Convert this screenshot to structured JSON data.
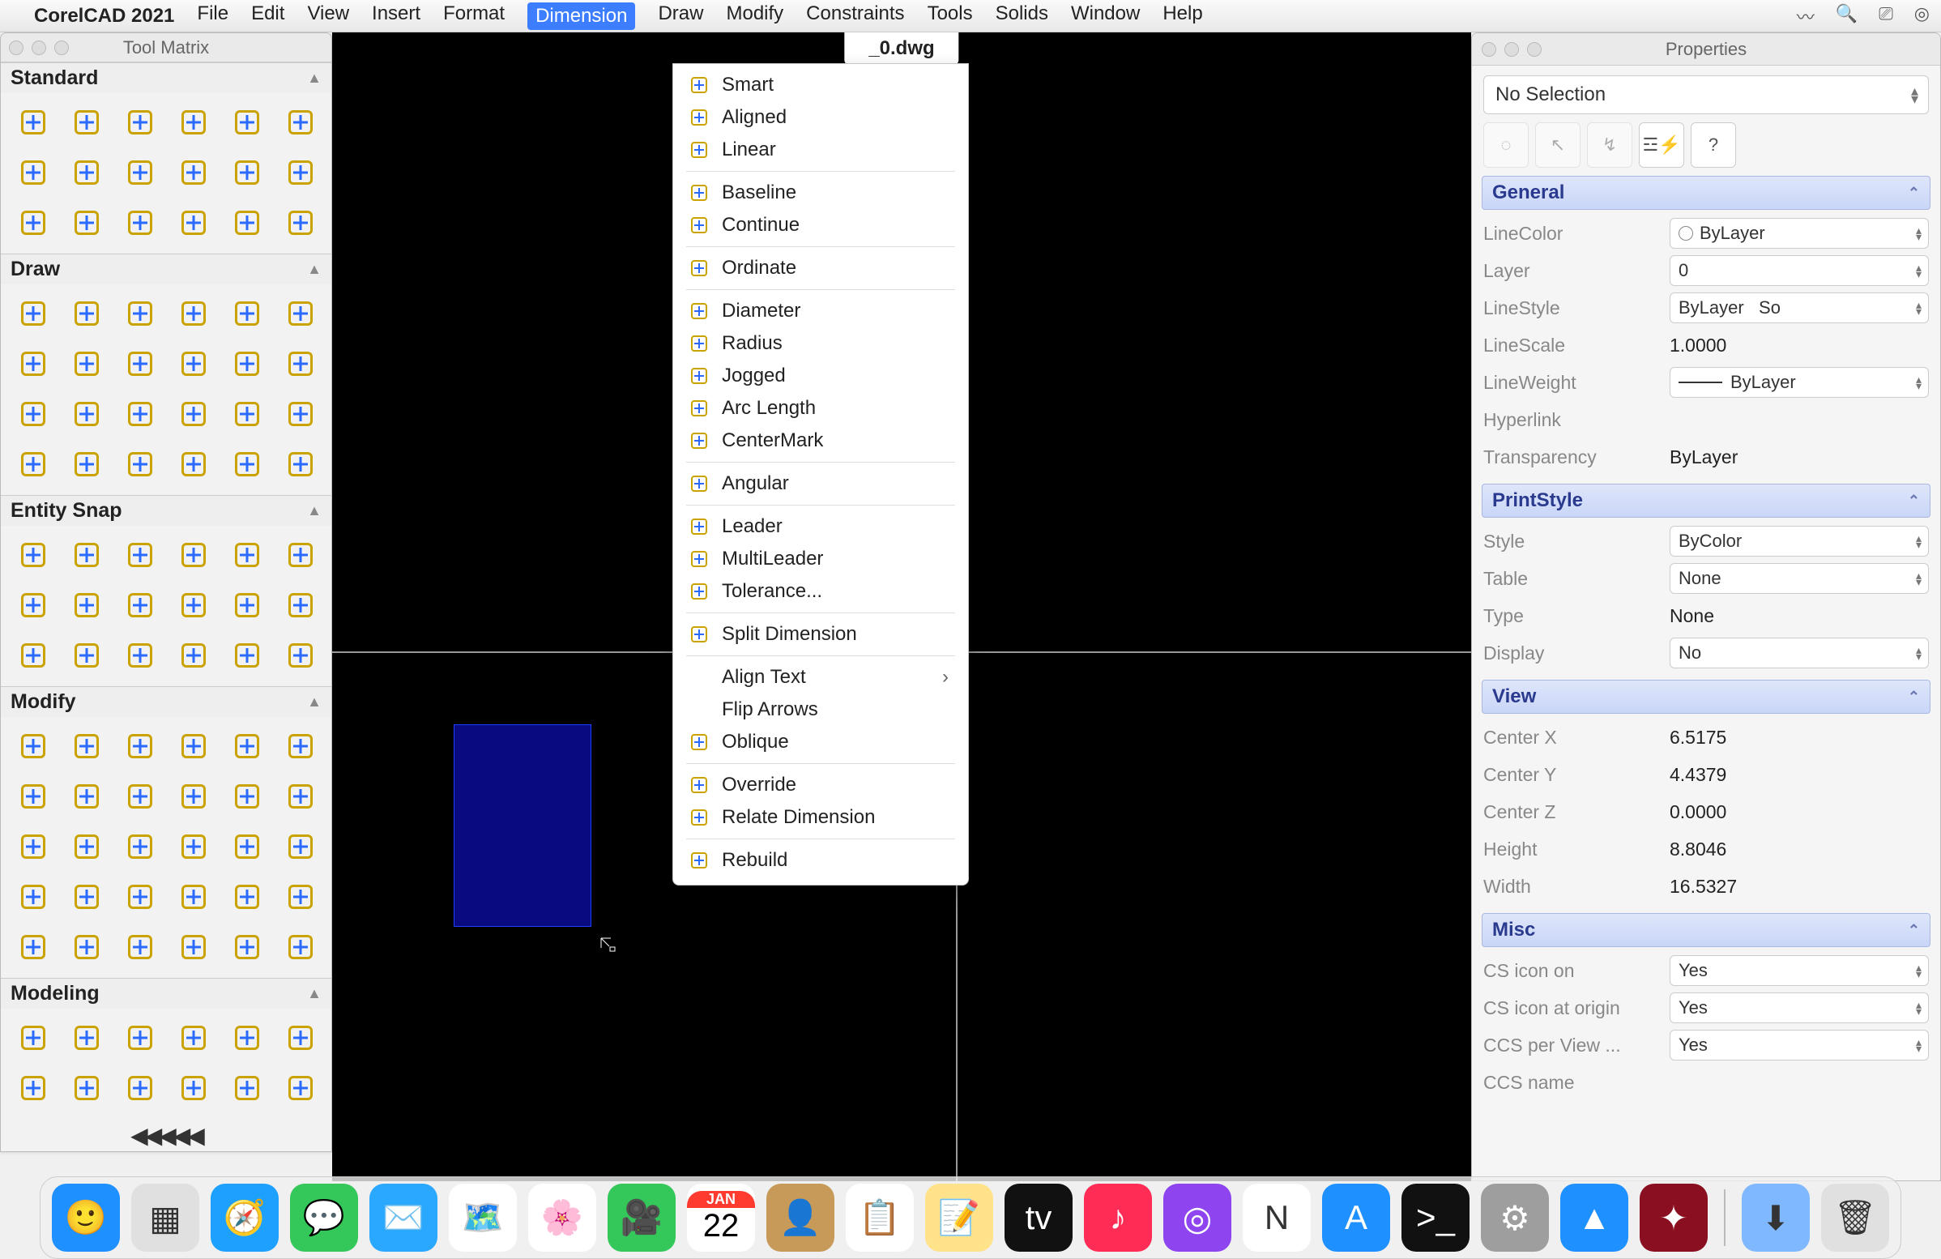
{
  "menubar": {
    "app_name": "CorelCAD 2021",
    "items": [
      "File",
      "Edit",
      "View",
      "Insert",
      "Format",
      "Dimension",
      "Draw",
      "Modify",
      "Constraints",
      "Tools",
      "Solids",
      "Window",
      "Help"
    ],
    "open_index": 5
  },
  "system_status": {
    "date_badge": {
      "month": "JAN",
      "day": "22"
    }
  },
  "toolmatrix": {
    "title": "Tool Matrix",
    "sections": [
      {
        "name": "Standard",
        "rows": 3,
        "cols": 6
      },
      {
        "name": "Draw",
        "rows": 4,
        "cols": 6
      },
      {
        "name": "Entity Snap",
        "rows": 3,
        "cols": 6
      },
      {
        "name": "Modify",
        "rows": 5,
        "cols": 6
      },
      {
        "name": "Modeling",
        "rows": 2,
        "cols": 6
      }
    ]
  },
  "document": {
    "tab_label": "_0.dwg"
  },
  "dimension_menu": {
    "groups": [
      [
        {
          "label": "Smart",
          "icon": "smart-dim"
        },
        {
          "label": "Aligned",
          "icon": "aligned-dim"
        },
        {
          "label": "Linear",
          "icon": "linear-dim"
        }
      ],
      [
        {
          "label": "Baseline",
          "icon": "baseline-dim"
        },
        {
          "label": "Continue",
          "icon": "continue-dim"
        }
      ],
      [
        {
          "label": "Ordinate",
          "icon": "ordinate-dim"
        }
      ],
      [
        {
          "label": "Diameter",
          "icon": "diameter-dim"
        },
        {
          "label": "Radius",
          "icon": "radius-dim"
        },
        {
          "label": "Jogged",
          "icon": "jogged-dim"
        },
        {
          "label": "Arc Length",
          "icon": "arclen-dim"
        },
        {
          "label": "CenterMark",
          "icon": "centermark-dim"
        }
      ],
      [
        {
          "label": "Angular",
          "icon": "angular-dim"
        }
      ],
      [
        {
          "label": "Leader",
          "icon": "leader-dim"
        },
        {
          "label": "MultiLeader",
          "icon": "multileader-dim"
        },
        {
          "label": "Tolerance...",
          "icon": "tolerance-dim"
        }
      ],
      [
        {
          "label": "Split Dimension",
          "icon": "split-dim"
        }
      ],
      [
        {
          "label": "Align Text",
          "icon": "",
          "submenu": true
        },
        {
          "label": "Flip Arrows",
          "icon": ""
        },
        {
          "label": "Oblique",
          "icon": "oblique-dim"
        }
      ],
      [
        {
          "label": "Override",
          "icon": "override-dim"
        },
        {
          "label": "Relate Dimension",
          "icon": "relate-dim"
        }
      ],
      [
        {
          "label": "Rebuild",
          "icon": "rebuild-dim"
        }
      ]
    ]
  },
  "properties": {
    "title": "Properties",
    "selection": "No Selection",
    "toolbar_help": "?",
    "groups": [
      {
        "name": "General",
        "rows": [
          {
            "label": "LineColor",
            "type": "select",
            "value": "ByLayer",
            "swatch": true
          },
          {
            "label": "Layer",
            "type": "select",
            "value": "0"
          },
          {
            "label": "LineStyle",
            "type": "select",
            "value": "ByLayer",
            "extra": "So"
          },
          {
            "label": "LineScale",
            "type": "value",
            "value": "1.0000"
          },
          {
            "label": "LineWeight",
            "type": "select",
            "value": "ByLayer",
            "line": true
          },
          {
            "label": "Hyperlink",
            "type": "value",
            "value": ""
          },
          {
            "label": "Transparency",
            "type": "value",
            "value": "ByLayer"
          }
        ]
      },
      {
        "name": "PrintStyle",
        "rows": [
          {
            "label": "Style",
            "type": "select",
            "value": "ByColor"
          },
          {
            "label": "Table",
            "type": "select",
            "value": "None"
          },
          {
            "label": "Type",
            "type": "value",
            "value": "None"
          },
          {
            "label": "Display",
            "type": "select",
            "value": "No"
          }
        ]
      },
      {
        "name": "View",
        "rows": [
          {
            "label": "Center X",
            "type": "value",
            "value": "6.5175"
          },
          {
            "label": "Center Y",
            "type": "value",
            "value": "4.4379"
          },
          {
            "label": "Center Z",
            "type": "value",
            "value": "0.0000"
          },
          {
            "label": "Height",
            "type": "value",
            "value": "8.8046"
          },
          {
            "label": "Width",
            "type": "value",
            "value": "16.5327"
          }
        ]
      },
      {
        "name": "Misc",
        "rows": [
          {
            "label": "CS icon on",
            "type": "select",
            "value": "Yes"
          },
          {
            "label": "CS icon at origin",
            "type": "select",
            "value": "Yes"
          },
          {
            "label": "CCS per View ...",
            "type": "select",
            "value": "Yes"
          },
          {
            "label": "CCS name",
            "type": "value",
            "value": ""
          }
        ]
      }
    ]
  },
  "dock": {
    "apps": [
      {
        "name": "finder",
        "bg": "#1e90ff",
        "glyph": "🙂"
      },
      {
        "name": "launchpad",
        "bg": "#e0e0e0",
        "glyph": "▦"
      },
      {
        "name": "safari",
        "bg": "#1ea0ff",
        "glyph": "🧭"
      },
      {
        "name": "messages",
        "bg": "#34c759",
        "glyph": "💬"
      },
      {
        "name": "mail",
        "bg": "#2aa7ff",
        "glyph": "✉️"
      },
      {
        "name": "maps",
        "bg": "#fff",
        "glyph": "🗺️"
      },
      {
        "name": "photos",
        "bg": "#fff",
        "glyph": "🌸"
      },
      {
        "name": "facetime",
        "bg": "#34c759",
        "glyph": "🎥"
      },
      {
        "name": "calendar",
        "bg": "#fff",
        "glyph": ""
      },
      {
        "name": "contacts",
        "bg": "#c79a5a",
        "glyph": "👤"
      },
      {
        "name": "reminders",
        "bg": "#fff",
        "glyph": "📋"
      },
      {
        "name": "notes",
        "bg": "#ffe28a",
        "glyph": "📝"
      },
      {
        "name": "tv",
        "bg": "#111",
        "glyph": "tv"
      },
      {
        "name": "music",
        "bg": "#ff2d55",
        "glyph": "♪"
      },
      {
        "name": "podcasts",
        "bg": "#8e44ef",
        "glyph": "◎"
      },
      {
        "name": "news",
        "bg": "#fff",
        "glyph": "N"
      },
      {
        "name": "appstore",
        "bg": "#1e90ff",
        "glyph": "A"
      },
      {
        "name": "terminal",
        "bg": "#111",
        "glyph": ">_"
      },
      {
        "name": "settings",
        "bg": "#9e9e9e",
        "glyph": "⚙"
      },
      {
        "name": "xcode",
        "bg": "#1e90ff",
        "glyph": "▲"
      },
      {
        "name": "corelcad",
        "bg": "#8a0f20",
        "glyph": "✦"
      }
    ],
    "tray": [
      {
        "name": "downloads",
        "bg": "#7fb8ff",
        "glyph": "⬇"
      },
      {
        "name": "trash",
        "bg": "#e0e0e0",
        "glyph": "🗑"
      }
    ]
  }
}
